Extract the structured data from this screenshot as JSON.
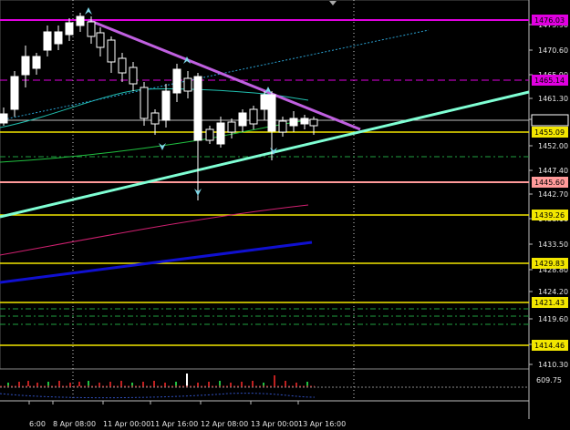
{
  "chart_data": {
    "type": "candlestick",
    "price_axis": {
      "ticks": [
        "1475.90",
        "1470.60",
        "1465.90",
        "1461.30",
        "1457.05",
        "1452.00",
        "1447.40",
        "1442.70",
        "1438.10",
        "1433.50",
        "1428.80",
        "1424.20",
        "1419.60",
        "1414.90",
        "1410.30"
      ]
    },
    "price_tags": [
      {
        "label": "1476.03",
        "color": "#e000e0"
      },
      {
        "label": "1465.14",
        "color": "#e000e0"
      },
      {
        "label": "1455.09",
        "color": "#f2e600"
      },
      {
        "label": "1445.60",
        "color": "#ff9a9a"
      },
      {
        "label": "1439.26",
        "color": "#f2e600"
      },
      {
        "label": "1429.83",
        "color": "#f2e600"
      },
      {
        "label": "1421.43",
        "color": "#f2e600"
      },
      {
        "label": "1414.46",
        "color": "#f2e600"
      }
    ],
    "indicator_label": "609.75",
    "time_labels": [
      "6:00",
      "8 Apr 08:00",
      "11 Apr 00:00",
      "11 Apr 16:00",
      "12 Apr 08:00",
      "13 Apr 00:00",
      "13 Apr 16:00"
    ],
    "colors": {
      "background": "#000000",
      "candle_bull": "#ffffff",
      "candle_bear": "#000000",
      "trendline_cyan": "#7fffd4",
      "trendline_violet": "#c060e0",
      "ma_blue": "#1010d0",
      "ma_pink": "#d02070",
      "ma_green": "#20c040",
      "ma_teal": "#20c0b0",
      "magenta_level": "#e000e0",
      "yellow_level": "#f2e600",
      "salmon_level": "#ff9a9a"
    }
  }
}
